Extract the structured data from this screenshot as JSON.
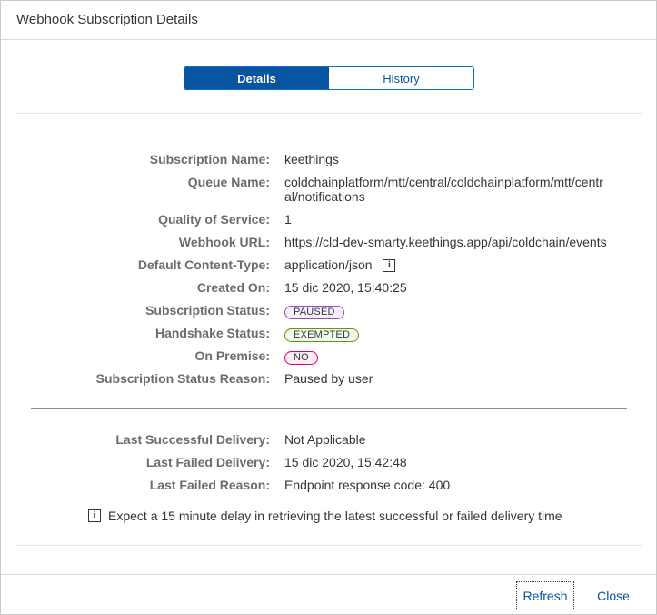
{
  "dialog": {
    "title": "Webhook Subscription Details"
  },
  "tabs": {
    "details": "Details",
    "history": "History"
  },
  "fields": {
    "subscription_name": {
      "label": "Subscription Name:",
      "value": "keethings"
    },
    "queue_name": {
      "label": "Queue Name:",
      "value": "coldchainplatform/mtt/central/coldchainplatform/mtt/central/notifications"
    },
    "qos": {
      "label": "Quality of Service:",
      "value": "1"
    },
    "webhook_url": {
      "label": "Webhook URL:",
      "value": "https://cld-dev-smarty.keethings.app/api/coldchain/events"
    },
    "content_type": {
      "label": "Default Content-Type:",
      "value": "application/json",
      "icon": "i"
    },
    "created_on": {
      "label": "Created On:",
      "value": "15 dic 2020, 15:40:25"
    },
    "subscription_status": {
      "label": "Subscription Status:",
      "value": "PAUSED",
      "color": "#8e4ec6",
      "bg": "#f6effc"
    },
    "handshake_status": {
      "label": "Handshake Status:",
      "value": "EXEMPTED",
      "color": "#5b9a00",
      "bg": "#f5faee"
    },
    "on_premise": {
      "label": "On Premise:",
      "value": "NO",
      "color": "#d6006f",
      "bg": "#fdeef5"
    },
    "status_reason": {
      "label": "Subscription Status Reason:",
      "value": "Paused by user"
    },
    "last_success": {
      "label": "Last Successful Delivery:",
      "value": "Not Applicable"
    },
    "last_failed": {
      "label": "Last Failed Delivery:",
      "value": "15 dic 2020, 15:42:48"
    },
    "last_failed_reason": {
      "label": "Last Failed Reason:",
      "value": "Endpoint response code: 400"
    }
  },
  "note": {
    "icon": "i",
    "text": "Expect a 15 minute delay in retrieving the latest successful or failed delivery time"
  },
  "footer": {
    "refresh": "Refresh",
    "close": "Close"
  }
}
